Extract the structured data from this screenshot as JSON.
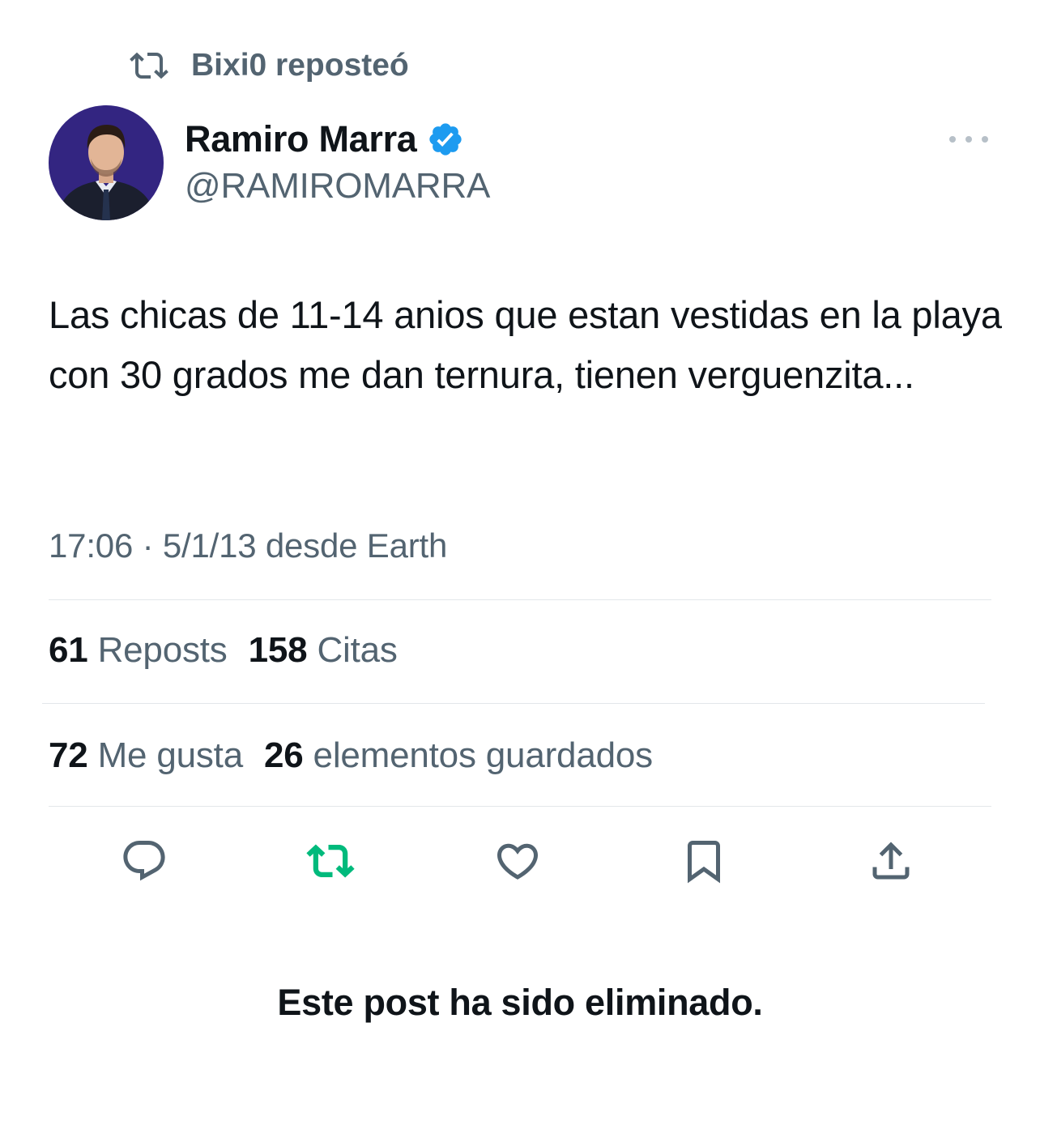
{
  "repost_header": {
    "icon": "retweet-icon",
    "text": "Bixi0 reposteó"
  },
  "author": {
    "avatar": "avatar-photo",
    "name": "Ramiro Marra",
    "verified_icon": "verified-badge-icon",
    "handle": "@RAMIROMARRA"
  },
  "more_icon": "more-options-icon",
  "tweet": {
    "text": "Las chicas de 11-14 anios que estan vestidas en la playa con 30 grados me dan ternura, tienen verguenzita...",
    "timestamp": "17:06 · 5/1/13 desde Earth"
  },
  "stats": {
    "reposts_count": "61",
    "reposts_label": "Reposts",
    "quotes_count": "158",
    "quotes_label": "Citas",
    "likes_count": "72",
    "likes_label": "Me gusta",
    "bookmarks_count": "26",
    "bookmarks_label": "elementos guardados"
  },
  "actions": [
    {
      "name": "reply",
      "icon": "reply-icon"
    },
    {
      "name": "repost",
      "icon": "retweet-icon",
      "active": true
    },
    {
      "name": "like",
      "icon": "heart-icon"
    },
    {
      "name": "bookmark",
      "icon": "bookmark-icon"
    },
    {
      "name": "share",
      "icon": "share-icon"
    }
  ],
  "colors": {
    "text_primary": "#0f1419",
    "text_secondary": "#536471",
    "verified_blue": "#1d9bf0",
    "repost_green": "#00ba7c",
    "divider": "#e3e7ea"
  },
  "deleted_notice": "Este post ha sido eliminado."
}
